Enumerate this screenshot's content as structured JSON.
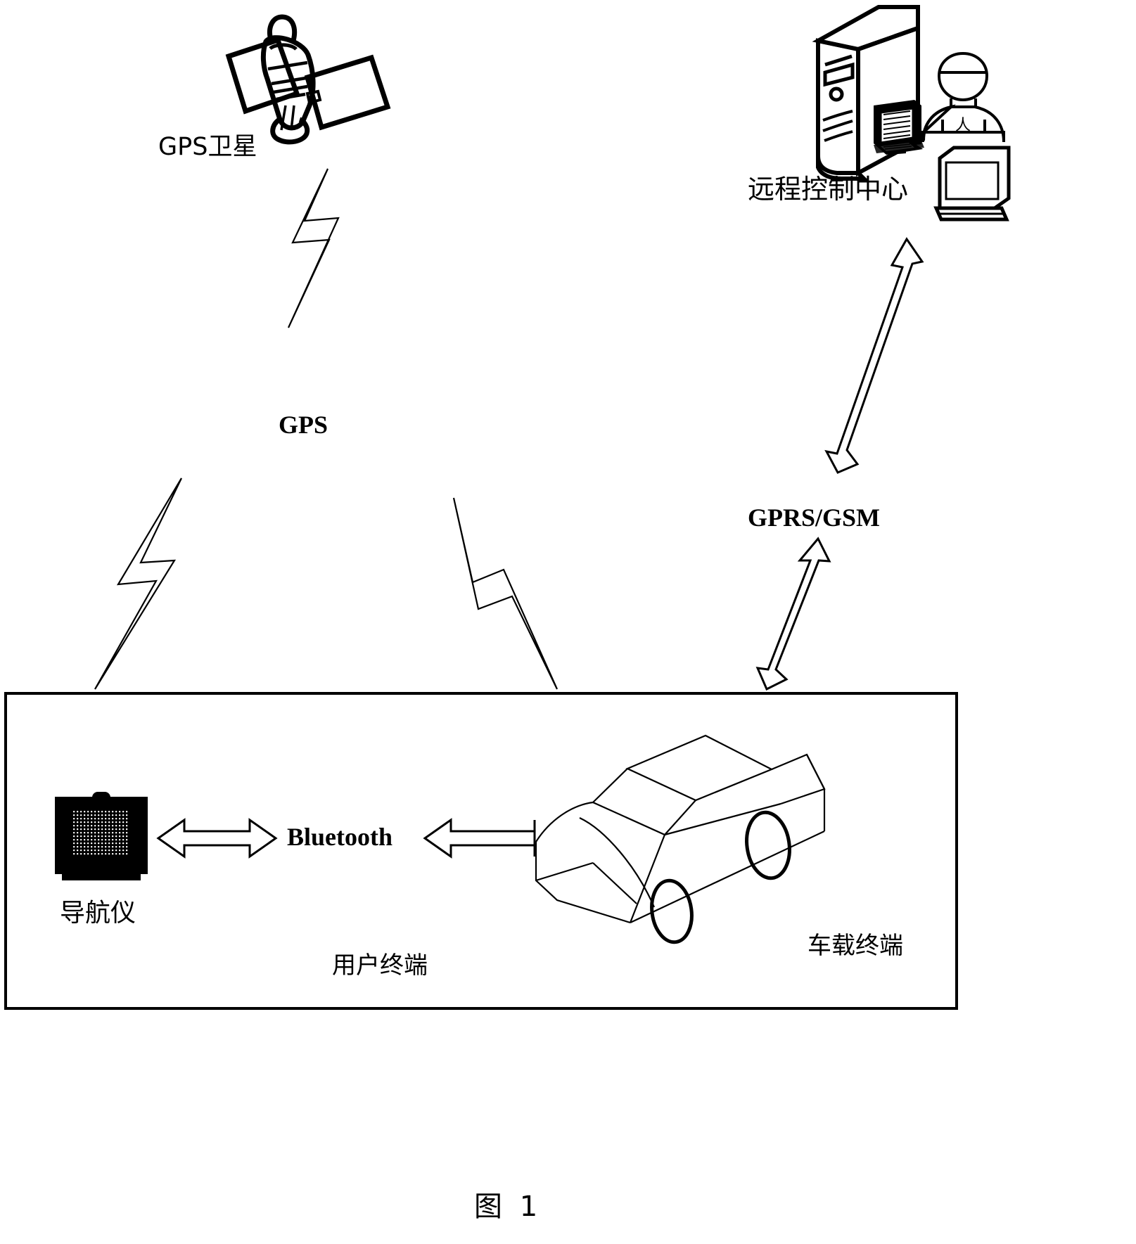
{
  "figure": {
    "caption": "图  1",
    "caption_label": "图",
    "caption_number": "1"
  },
  "nodes": {
    "gps_satellite": {
      "label": "GPS卫星",
      "icon": "satellite-icon"
    },
    "remote_control_center": {
      "label": "远程控制中心",
      "icon": "server-tower-icon",
      "operator_label": "人",
      "operator_icon": "person-icon",
      "laptop_icon": "laptop-icon",
      "monitor_icon": "desktop-monitor-icon"
    },
    "user_terminal": {
      "label": "用户终端",
      "boundary": "user-terminal-box"
    },
    "navigator": {
      "label": "导航仪",
      "icon": "navigator-device-icon"
    },
    "vehicle_terminal": {
      "label": "车载终端",
      "icon": "car-icon"
    }
  },
  "links": {
    "gps_downlink": {
      "label": "GPS",
      "icon": "lightning-bolt-icon",
      "description": "GPS卫星 to 用户终端"
    },
    "gprs_gsm": {
      "label": "GPRS/GSM",
      "icon": "double-arrow-icon",
      "description": "远程控制中心 to 车载终端"
    },
    "bluetooth": {
      "label": "Bluetooth",
      "icon": "double-arrow-icon",
      "description": "导航仪 to 车载终端"
    }
  },
  "colors": {
    "ink": "#000000",
    "paper": "#ffffff"
  }
}
